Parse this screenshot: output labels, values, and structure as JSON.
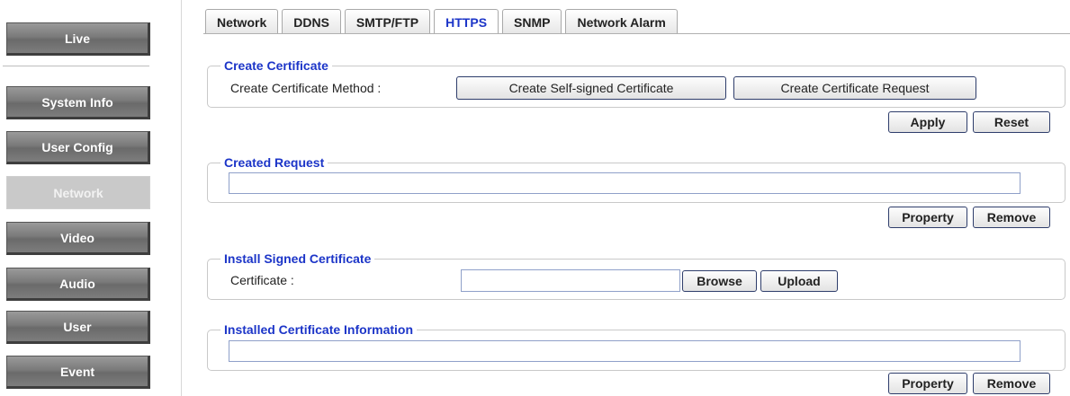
{
  "sidebar": {
    "items": [
      {
        "label": "Live"
      },
      {
        "label": "System Info"
      },
      {
        "label": "User Config"
      },
      {
        "label": "Network"
      },
      {
        "label": "Video"
      },
      {
        "label": "Audio"
      },
      {
        "label": "User"
      },
      {
        "label": "Event"
      }
    ]
  },
  "tabs": [
    {
      "label": "Network"
    },
    {
      "label": "DDNS"
    },
    {
      "label": "SMTP/FTP"
    },
    {
      "label": "HTTPS"
    },
    {
      "label": "SNMP"
    },
    {
      "label": "Network Alarm"
    }
  ],
  "active_tab": "HTTPS",
  "create_certificate": {
    "legend": "Create Certificate",
    "method_label": "Create Certificate Method :",
    "self_signed_button": "Create Self-signed Certificate",
    "request_button": "Create Certificate Request",
    "apply_button": "Apply",
    "reset_button": "Reset"
  },
  "created_request": {
    "legend": "Created Request",
    "value": "",
    "property_button": "Property",
    "remove_button": "Remove"
  },
  "install_signed": {
    "legend": "Install Signed Certificate",
    "certificate_label": "Certificate :",
    "file_value": "",
    "browse_button": "Browse",
    "upload_button": "Upload"
  },
  "installed_info": {
    "legend": "Installed Certificate Information",
    "value": "",
    "property_button": "Property",
    "remove_button": "Remove"
  },
  "colors": {
    "accent": "#1c35c8",
    "sidebar_button": "#7a7a7a",
    "sidebar_active": "#c9c9c9"
  }
}
